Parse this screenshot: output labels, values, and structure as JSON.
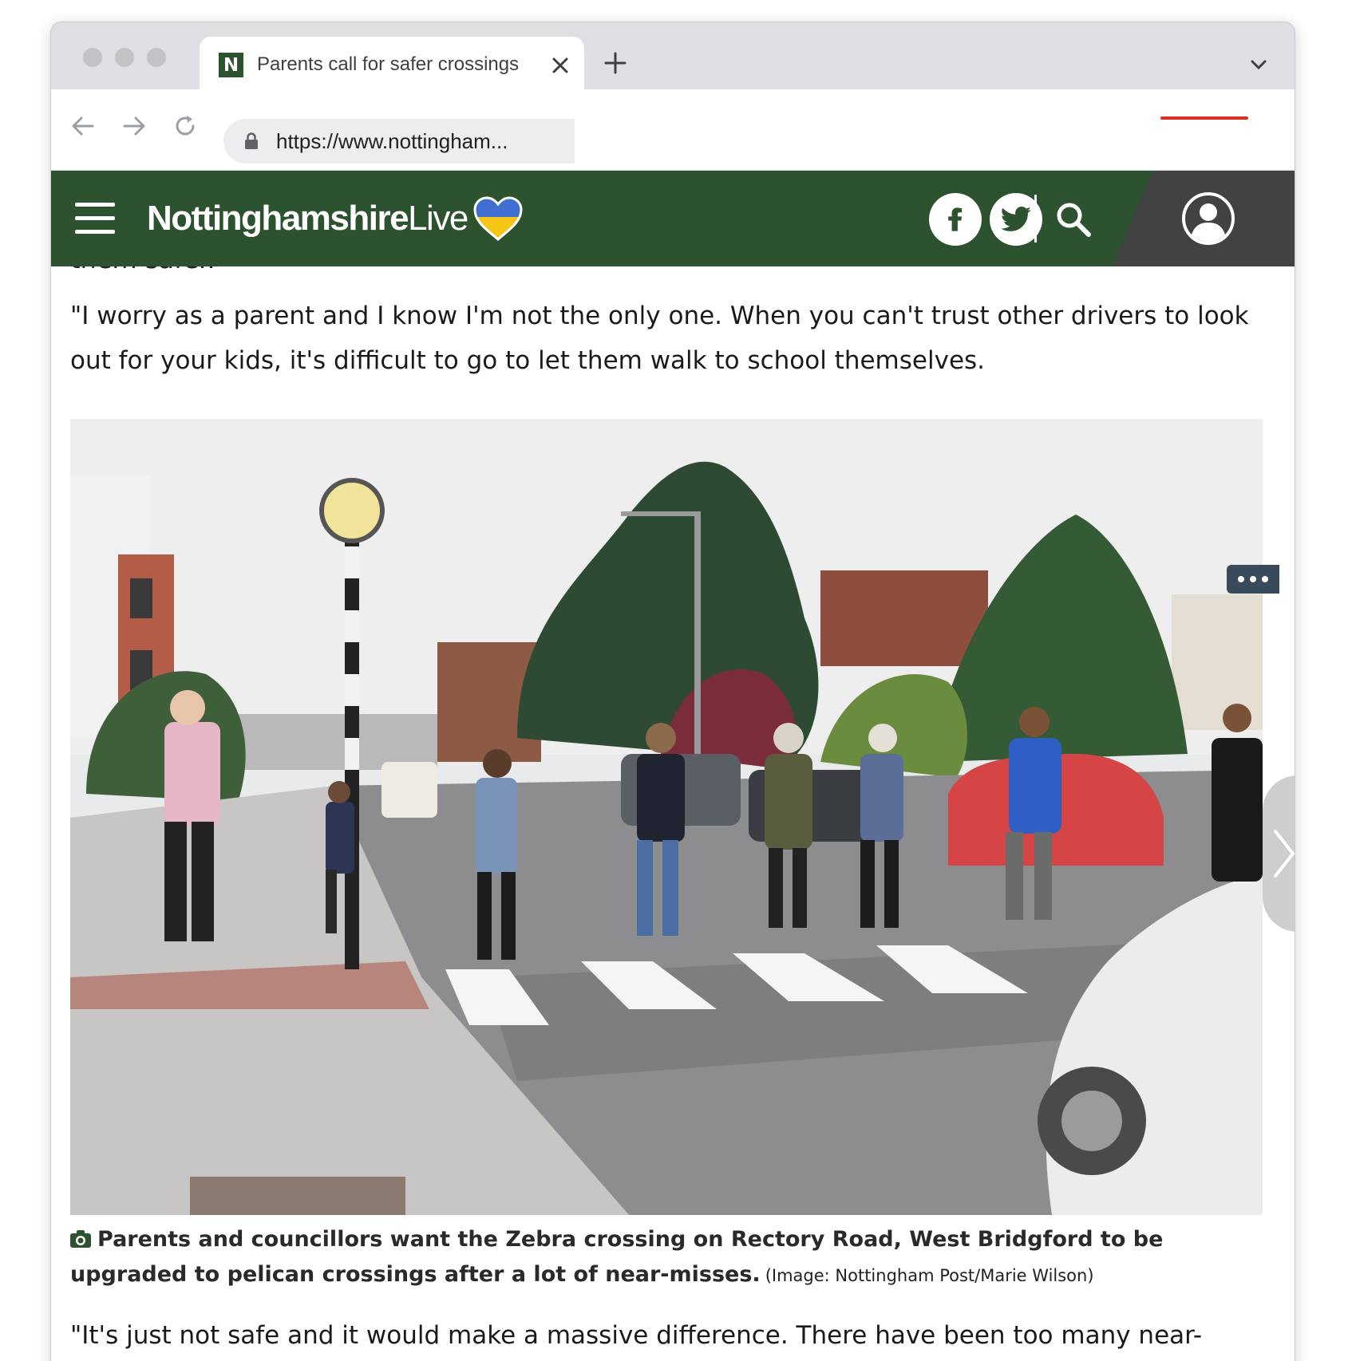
{
  "browser": {
    "tab_title": "Parents call for safer crossings",
    "favicon_letter": "N",
    "url": "https://www.nottingham..."
  },
  "site": {
    "logo_bold": "Nottinghamshire",
    "logo_light": "Live",
    "brand_color": "#2d5230",
    "heart_colors": [
      "#3f6fd1",
      "#f5c518"
    ]
  },
  "article": {
    "clipped_text": "them safer.",
    "paragraph_1": "\"I worry as a parent and I know I'm not the only one. When you can't trust other drivers to look out for your kids, it's difficult to go to let them walk to school themselves.",
    "caption": "Parents and councillors want the Zebra crossing on Rectory Road, West Bridgford to be upgraded to pelican crossings after a lot of near-misses.",
    "credit": "(Image: Nottingham Post/Marie Wilson)",
    "paragraph_2": "\"It's just not safe and it would make a massive difference. There have been too many near-misses.\""
  }
}
